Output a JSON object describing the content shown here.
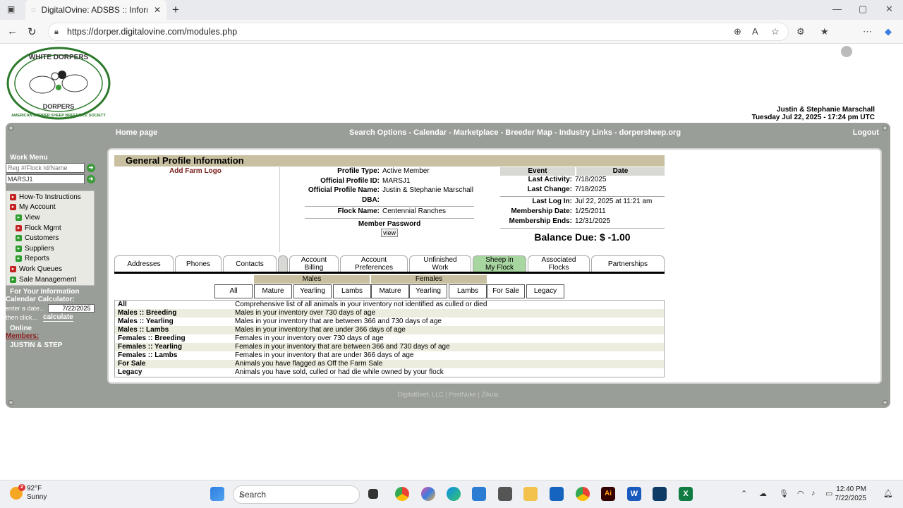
{
  "browser": {
    "tab_title": "DigitalOvine: ADSBS :: Information",
    "url": "https://dorper.digitalovine.com/modules.php",
    "new_tab_label": "+"
  },
  "logo_text": [
    "WHITE DORPERS",
    "DORPERS",
    "AMERICAN DORPER SHEEP BREEDERS' SOCIETY"
  ],
  "user": {
    "name": "Justin & Stephanie Marschall",
    "datetime": "Tuesday Jul 22, 2025 - 17:24 pm UTC"
  },
  "nav": {
    "home": "Home page",
    "links": "Search Options - Calendar - Marketplace - Breeder Map - Industry Links - dorpersheep.org",
    "logout": "Logout"
  },
  "sidebar": {
    "work_menu": "Work Menu",
    "search_placeholder": "Reg #/Flock Id/Name",
    "flock_value": "MARSJ1",
    "items": [
      {
        "label": "How-To Instructions",
        "color": "red",
        "sub": false
      },
      {
        "label": "My Account",
        "color": "red",
        "sub": false
      },
      {
        "label": "View",
        "color": "green",
        "sub": true
      },
      {
        "label": "Flock Mgmt",
        "color": "red",
        "sub": true
      },
      {
        "label": "Customers",
        "color": "green",
        "sub": true
      },
      {
        "label": "Suppliers",
        "color": "green",
        "sub": true
      },
      {
        "label": "Reports",
        "color": "green",
        "sub": true
      },
      {
        "label": "Work Queues",
        "color": "red",
        "sub": false
      },
      {
        "label": "Sale Management",
        "color": "green",
        "sub": false
      }
    ],
    "for_your_info": "For Your Information",
    "calendar_calc": "Calendar Calculator:",
    "enter_date": "enter a date...",
    "date_value": "7/22/2025",
    "then_click": "then click...",
    "calculate": "calculate",
    "online": "Online",
    "members": "Members:",
    "member_name": "JUSTIN & STEP"
  },
  "profile": {
    "title": "General Profile Information",
    "add_logo": "Add Farm Logo",
    "fields": [
      {
        "k": "Profile Type:",
        "v": "Active Member"
      },
      {
        "k": "Official Profile ID:",
        "v": "MARSJ1"
      },
      {
        "k": "Official Profile Name:",
        "v": "Justin & Stephanie Marschall"
      },
      {
        "k": "DBA:",
        "v": ""
      }
    ],
    "flock_label": "Flock Name:",
    "flock_name": "Centennial Ranches",
    "member_password": "Member Password",
    "view_btn": "view"
  },
  "events": {
    "h_event": "Event",
    "h_date": "Date",
    "rows": [
      {
        "k": "Last Activity:",
        "v": "7/18/2025"
      },
      {
        "k": "Last Change:",
        "v": "7/18/2025"
      }
    ],
    "rows2": [
      {
        "k": "Last Log In:",
        "v": "Jul 22, 2025 at 11:21 am"
      },
      {
        "k": "Membership Date:",
        "v": "1/25/2011"
      },
      {
        "k": "Membership Ends:",
        "v": "12/31/2025"
      }
    ],
    "balance": "Balance Due: $ -1.00"
  },
  "tabs": [
    {
      "l1": "Addresses",
      "l2": ""
    },
    {
      "l1": "Phones",
      "l2": ""
    },
    {
      "l1": "Contacts",
      "l2": ""
    },
    {
      "l1": "",
      "l2": ""
    },
    {
      "l1": "Account",
      "l2": "Billing"
    },
    {
      "l1": "Account",
      "l2": "Preferences"
    },
    {
      "l1": "Unfinished",
      "l2": "Work"
    },
    {
      "l1": "Sheep in",
      "l2": "My Flock"
    },
    {
      "l1": "Associated",
      "l2": "Flocks"
    },
    {
      "l1": "Partnerships",
      "l2": ""
    }
  ],
  "filters": {
    "males": "Males",
    "females": "Females",
    "buttons": [
      "All",
      "Mature",
      "Yearling",
      "Lambs",
      "Mature",
      "Yearling",
      "Lambs",
      "For Sale",
      "Legacy"
    ]
  },
  "descriptions": [
    {
      "n": "All",
      "d": "Comprehensive list of all animals in your inventory not identified as culled or died"
    },
    {
      "n": "Males :: Breeding",
      "d": "Males in your inventory over 730 days of age"
    },
    {
      "n": "Males :: Yearling",
      "d": "Males in your inventory that are between 366 and 730 days of age"
    },
    {
      "n": "Males :: Lambs",
      "d": "Males in your inventory that are under 366 days of age"
    },
    {
      "n": "Females :: Breeding",
      "d": "Females in your inventory over 730 days of age"
    },
    {
      "n": "Females :: Yearling",
      "d": "Females in your inventory that are between 366 and 730 days of age"
    },
    {
      "n": "Females :: Lambs",
      "d": "Females in your inventory that are under 366 days of age"
    },
    {
      "n": "For Sale",
      "d": "Animals you have flagged as Off the Farm Sale"
    },
    {
      "n": "Legacy",
      "d": "Animals you have sold, culled or had die while owned by your flock"
    }
  ],
  "footer": "DigitalBeef, LLC | PostNuke | Zikula",
  "taskbar": {
    "temp": "92°F",
    "cond": "Sunny",
    "badge": "2",
    "search": "Search",
    "time": "12:40 PM",
    "date": "7/22/2025"
  }
}
